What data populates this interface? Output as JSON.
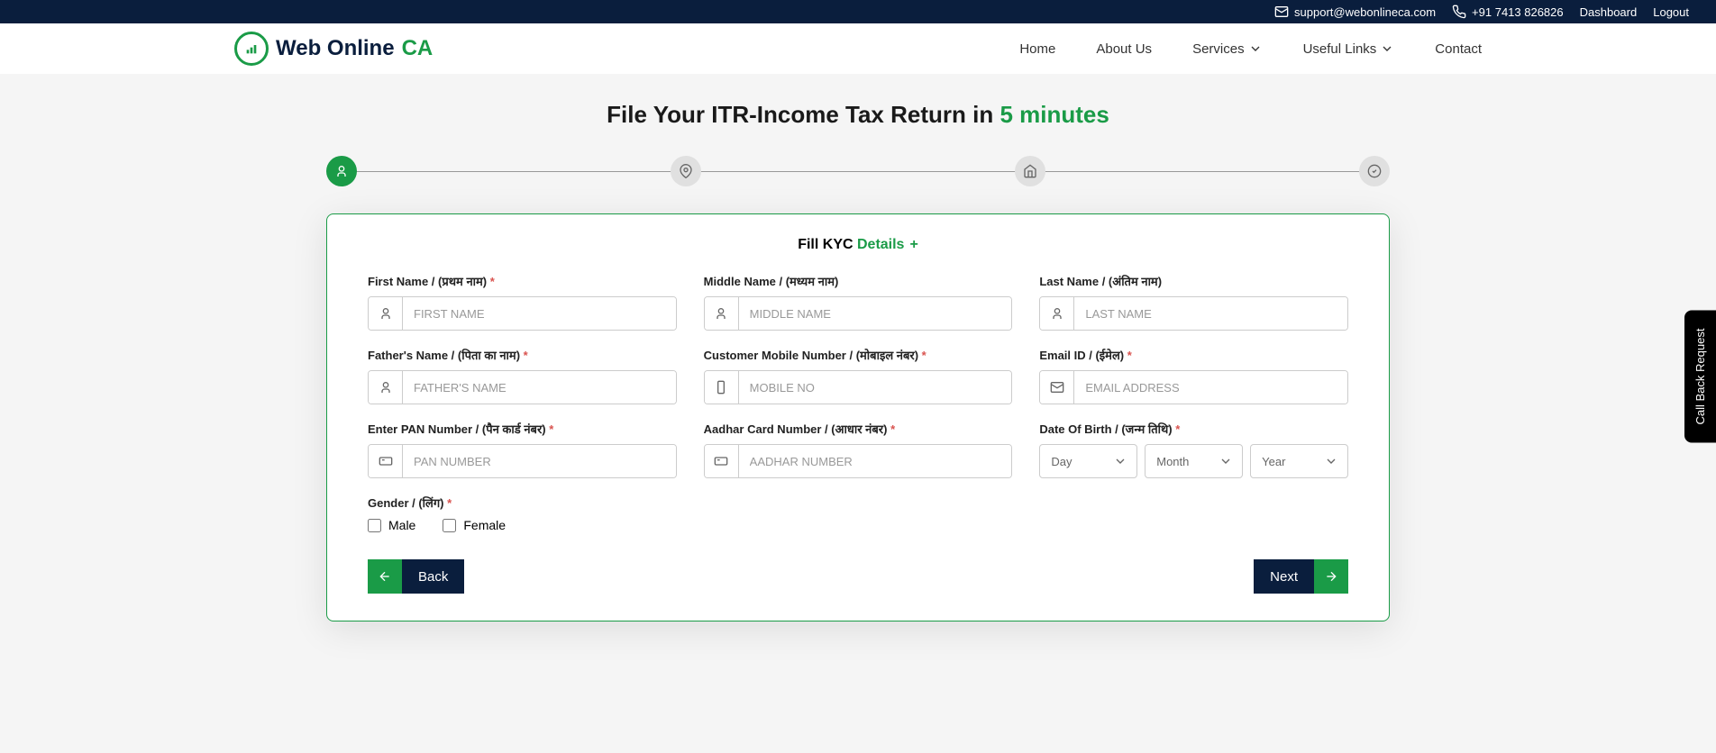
{
  "topbar": {
    "email": "support@webonlineca.com",
    "phone": "+91 7413 826826",
    "dashboard": "Dashboard",
    "logout": "Logout"
  },
  "logo": {
    "text1": "Web Online ",
    "text2": "CA"
  },
  "nav": {
    "home": "Home",
    "about": "About Us",
    "services": "Services",
    "links": "Useful Links",
    "contact": "Contact"
  },
  "title": {
    "main": "File Your ITR-Income Tax Return in ",
    "highlight": "5 minutes"
  },
  "form": {
    "title_prefix": "Fill KYC ",
    "title_highlight": "Details",
    "first_name": {
      "label": "First Name / (प्रथम नाम)",
      "placeholder": "FIRST NAME"
    },
    "middle_name": {
      "label": "Middle Name / (मध्यम नाम)",
      "placeholder": "MIDDLE NAME"
    },
    "last_name": {
      "label": "Last Name / (अंतिम नाम)",
      "placeholder": "LAST NAME"
    },
    "father_name": {
      "label": "Father's Name / (पिता का नाम)",
      "placeholder": "FATHER'S NAME"
    },
    "mobile": {
      "label": "Customer Mobile Number / (मोबाइल नंबर)",
      "placeholder": "MOBILE NO"
    },
    "email": {
      "label": "Email ID / (ईमेल)",
      "placeholder": "EMAIL ADDRESS"
    },
    "pan": {
      "label": "Enter PAN Number / (पैन कार्ड नंबर)",
      "placeholder": "PAN NUMBER"
    },
    "aadhar": {
      "label": "Aadhar Card Number / (आधार नंबर)",
      "placeholder": "AADHAR NUMBER"
    },
    "dob": {
      "label": "Date Of Birth / (जन्म तिथि)",
      "day": "Day",
      "month": "Month",
      "year": "Year"
    },
    "gender": {
      "label": "Gender / (लिंग)",
      "male": "Male",
      "female": "Female"
    }
  },
  "buttons": {
    "back": "Back",
    "next": "Next"
  },
  "callback": "Call Back Request"
}
